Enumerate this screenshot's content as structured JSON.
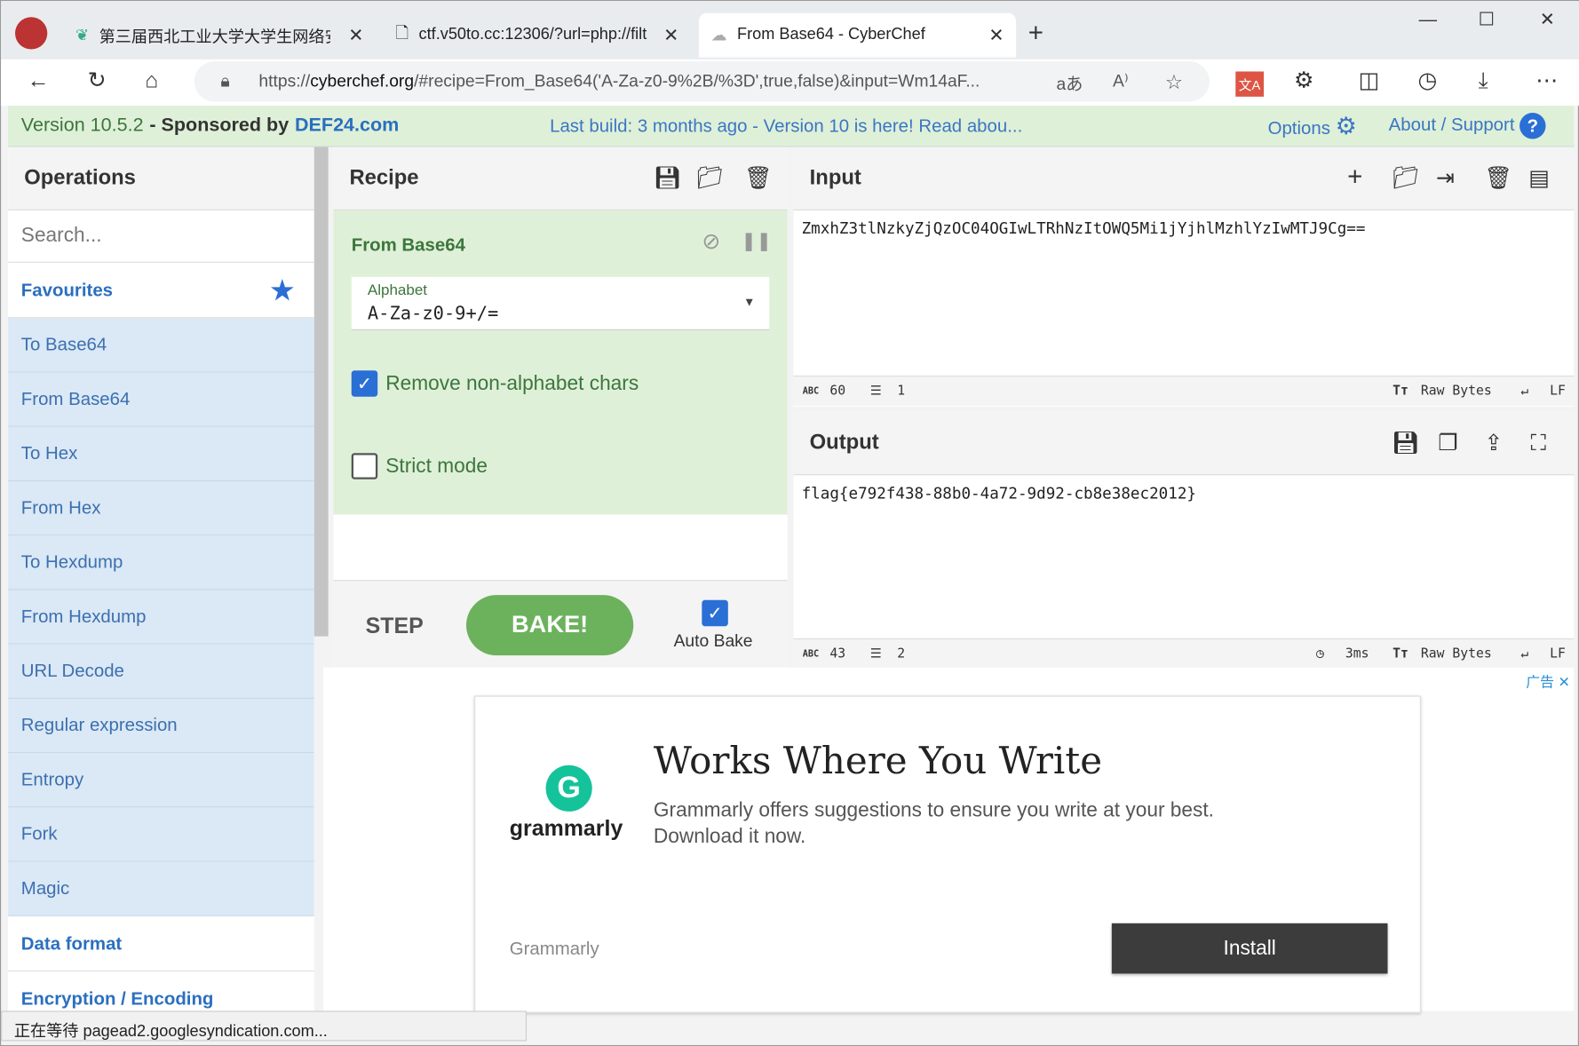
{
  "browser": {
    "tabs": [
      {
        "title": "第三届西北工业大学大学生网络安",
        "active": false
      },
      {
        "title": "ctf.v50to.cc:12306/?url=php://filt",
        "active": false
      },
      {
        "title": "From Base64 - CyberChef",
        "active": true
      }
    ],
    "url_prefix": "https://",
    "url_domain": "cyberchef.org",
    "url_rest": "/#recipe=From_Base64('A-Za-z0-9%2B/%3D',true,false)&input=Wm14aF...",
    "status_text": "正在等待 pagead2.googlesyndication.com..."
  },
  "banner": {
    "version": "Version 10.5.2",
    "sponsored": "- Sponsored by",
    "sponsor": "DEF24.com",
    "last_build": "Last build: 3 months ago - Version 10 is here! Read abou...",
    "options": "Options",
    "about": "About / Support"
  },
  "operations": {
    "title": "Operations",
    "search_placeholder": "Search...",
    "favourites": "Favourites",
    "items": [
      "To Base64",
      "From Base64",
      "To Hex",
      "From Hex",
      "To Hexdump",
      "From Hexdump",
      "URL Decode",
      "Regular expression",
      "Entropy",
      "Fork",
      "Magic"
    ],
    "categories": [
      "Data format",
      "Encryption / Encoding"
    ]
  },
  "recipe": {
    "title": "Recipe",
    "operation": "From Base64",
    "alphabet_label": "Alphabet",
    "alphabet_value": "A-Za-z0-9+/=",
    "remove_nonalpha": {
      "label": "Remove non-alphabet chars",
      "checked": true
    },
    "strict_mode": {
      "label": "Strict mode",
      "checked": false
    },
    "step": "STEP",
    "bake": "BAKE!",
    "auto_bake": {
      "label": "Auto Bake",
      "checked": true
    }
  },
  "input": {
    "title": "Input",
    "value": "ZmxhZ3tlNzkyZjQzOC04OGIwLTRhNzItOWQ5Mi1jYjhlMzhlYzIwMTJ9Cg==",
    "chars": "60",
    "lines": "1",
    "encoding": "Raw Bytes",
    "eol": "LF"
  },
  "output": {
    "title": "Output",
    "value": "flag{e792f438-88b0-4a72-9d92-cb8e38ec2012}",
    "chars": "43",
    "lines": "2",
    "time": "3ms",
    "encoding": "Raw Bytes",
    "eol": "LF"
  },
  "ad": {
    "label": "广告",
    "brand": "grammarly",
    "headline": "Works Where You Write",
    "body": "Grammarly offers suggestions to ensure you write at your best. Download it now.",
    "advertiser": "Grammarly",
    "cta": "Install"
  },
  "colors": {
    "accent": "#2a6fd6",
    "recipe_bg": "#dff0d8",
    "bake": "#6cb25d",
    "op_bg": "#dbe8f5"
  }
}
